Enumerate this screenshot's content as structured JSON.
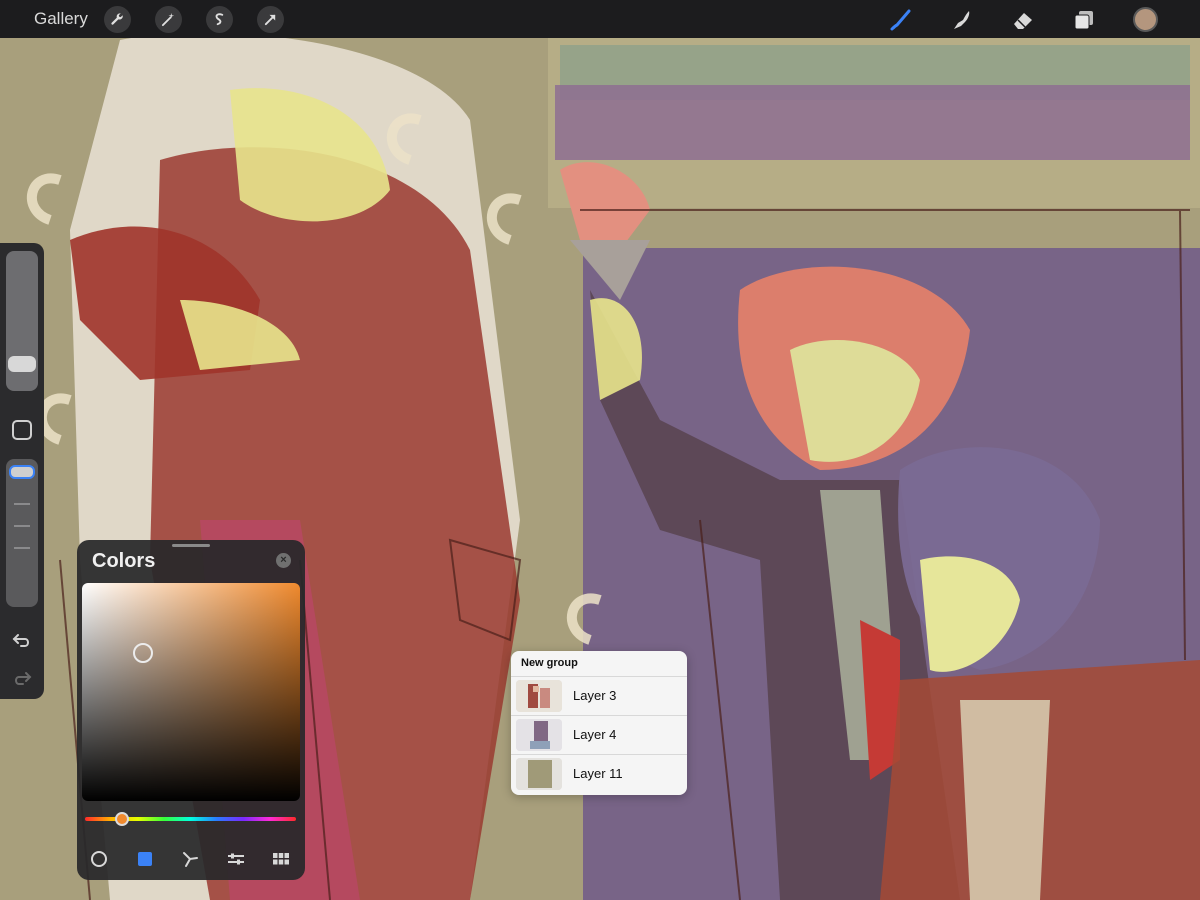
{
  "topbar": {
    "gallery_label": "Gallery",
    "left_tools": [
      "wrench-icon",
      "magic-wand-icon",
      "selection-icon",
      "transform-arrow-icon"
    ],
    "right_tools": [
      "brush-icon",
      "smudge-icon",
      "eraser-icon",
      "layers-icon"
    ],
    "active_tool": "brush-icon",
    "current_color": "#b4967e"
  },
  "sidebar": {
    "brush_size_level": 0.15,
    "opacity_level": 1.0,
    "tools": [
      "modify-square-icon",
      "undo-icon",
      "redo-icon"
    ]
  },
  "colors_panel": {
    "title": "Colors",
    "selected_color": "#f08a2e",
    "modes": [
      "disc-mode-icon",
      "classic-mode-icon",
      "harmony-mode-icon",
      "value-mode-icon",
      "palettes-mode-icon"
    ],
    "active_mode": "classic-mode-icon"
  },
  "layer_popup": {
    "header": "New group",
    "layers": [
      {
        "name": "Layer 3"
      },
      {
        "name": "Layer 4"
      },
      {
        "name": "Layer 11"
      }
    ]
  }
}
